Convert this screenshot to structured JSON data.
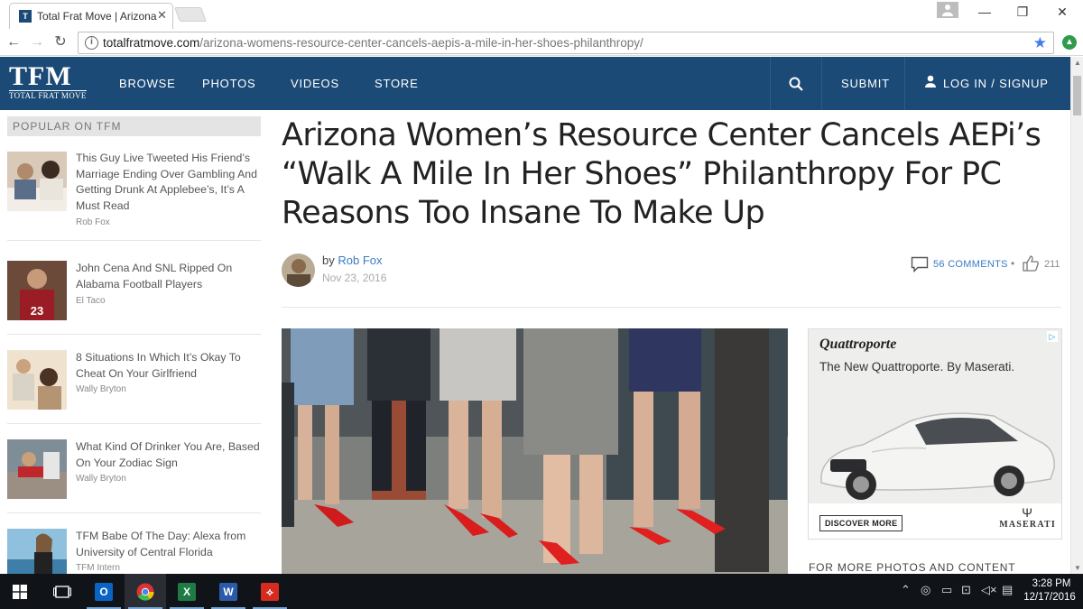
{
  "browser": {
    "tab_title": "Total Frat Move | Arizona",
    "url_host": "totalfratmove.com",
    "url_path": "/arizona-womens-resource-center-cancels-aepis-a-mile-in-her-shoes-philanthropy/"
  },
  "site": {
    "logo_big": "TFM",
    "logo_small": "TOTAL FRAT MOVE",
    "nav": [
      "BROWSE",
      "PHOTOS",
      "VIDEOS",
      "STORE"
    ],
    "submit": "SUBMIT",
    "login": "LOG IN / SIGNUP"
  },
  "sidebar": {
    "heading": "POPULAR ON TFM",
    "items": [
      {
        "title": "This Guy Live Tweeted His Friend’s Marriage Ending Over Gambling And Getting Drunk At Applebee’s, It’s A Must Read",
        "author": "Rob Fox"
      },
      {
        "title": "John Cena And SNL Ripped On Alabama Football Players",
        "author": "El Taco"
      },
      {
        "title": "8 Situations In Which It’s Okay To Cheat On Your Girlfriend",
        "author": "Wally Bryton"
      },
      {
        "title": "What Kind Of Drinker You Are, Based On Your Zodiac Sign",
        "author": "Wally Bryton"
      },
      {
        "title": "TFM Babe Of The Day: Alexa from University of Central Florida",
        "author": "TFM Intern"
      }
    ]
  },
  "article": {
    "headline": "Arizona Women’s Resource Center Cancels AEPi’s “Walk A Mile In Her Shoes” Philanthropy For PC Reasons Too Insane To Make Up",
    "by": "by",
    "author": "Rob Fox",
    "date": "Nov 23, 2016",
    "comments": "56 COMMENTS",
    "separator": "•",
    "likes": "211"
  },
  "ad": {
    "brand": "Quattroporte",
    "tagline": "The New Quattroporte. By Maserati.",
    "cta": "DISCOVER MORE",
    "logo": "MASERATI"
  },
  "below_ad": "FOR MORE PHOTOS AND CONTENT",
  "taskbar": {
    "time": "3:28 PM",
    "date": "12/17/2016"
  }
}
